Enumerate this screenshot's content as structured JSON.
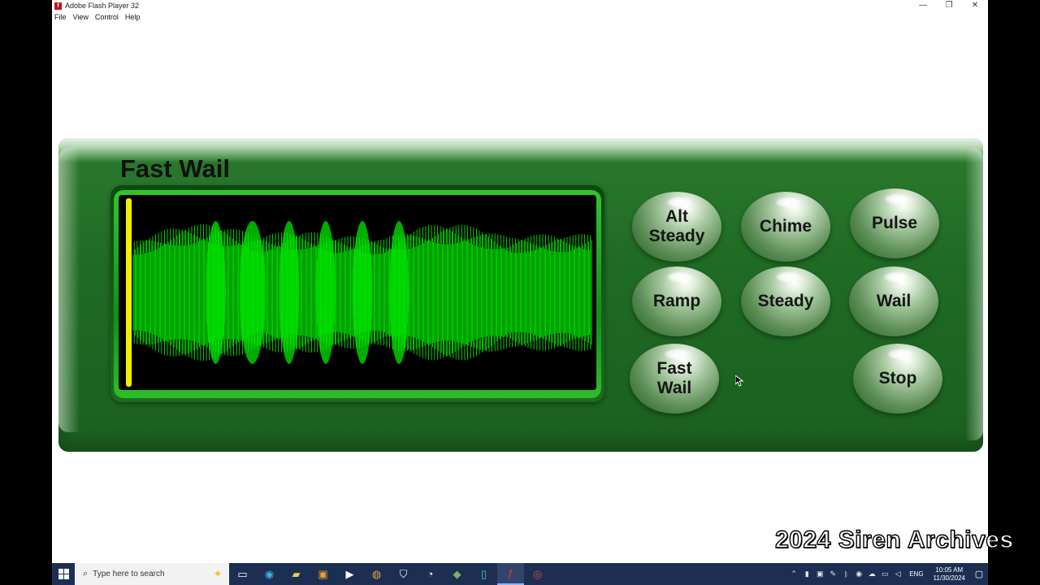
{
  "window": {
    "title": "Adobe Flash Player 32",
    "controls": {
      "minimize": "—",
      "restore": "❐",
      "close": "✕"
    }
  },
  "menu": [
    "File",
    "View",
    "Control",
    "Help"
  ],
  "siren": {
    "current_mode": "Fast Wail",
    "playback_progress": 0.0,
    "buttons": {
      "alt_steady": "Alt\nSteady",
      "chime": "Chime",
      "pulse": "Pulse",
      "ramp": "Ramp",
      "steady": "Steady",
      "wail": "Wail",
      "fast_wail": "Fast\nWail",
      "stop": "Stop"
    },
    "colors": {
      "panel": "#1f6b24",
      "waveform": "#00e600",
      "playhead": "#f2f000"
    }
  },
  "watermark": "2024 Siren Archives",
  "taskbar": {
    "search_placeholder": "Type here to search",
    "language": "ENG",
    "time": "10:05 AM",
    "date": "11/30/2024"
  }
}
